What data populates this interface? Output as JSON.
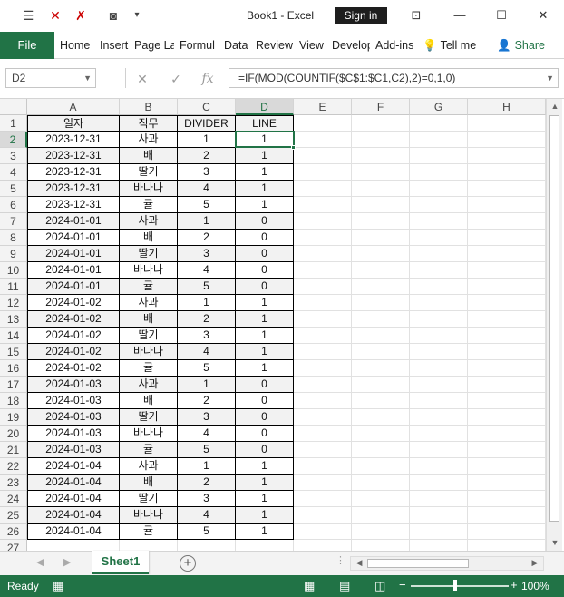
{
  "app": {
    "title": "Book1  -  Excel",
    "signin_label": "Sign in"
  },
  "quick_access": [
    {
      "icon": "form-icon",
      "glyph": "☰"
    },
    {
      "icon": "delete-cells-icon",
      "glyph": "✕"
    },
    {
      "icon": "clear-icon",
      "glyph": "✗"
    },
    {
      "icon": "camera-icon",
      "glyph": "◙"
    },
    {
      "icon": "customize-qat-icon",
      "glyph": "▾"
    }
  ],
  "window_buttons": [
    {
      "icon": "ribbon-display-icon",
      "glyph": "⊡"
    },
    {
      "icon": "minimize-icon",
      "glyph": "—"
    },
    {
      "icon": "maximize-icon",
      "glyph": "☐"
    },
    {
      "icon": "close-icon",
      "glyph": "✕"
    }
  ],
  "ribbon": {
    "file_label": "File",
    "tabs": [
      "Home",
      "Insert",
      "Page La",
      "Formul",
      "Data",
      "Review",
      "View",
      "Develop",
      "Add-ins"
    ],
    "tell_me": "Tell me",
    "share": "Share"
  },
  "formula_bar": {
    "name_box": "D2",
    "cancel_glyph": "✕",
    "enter_glyph": "✓",
    "fx_glyph": "fx",
    "formula": "=IF(MOD(COUNTIF($C$1:$C1,C2),2)=0,1,0)"
  },
  "grid": {
    "columns": [
      "A",
      "B",
      "C",
      "D",
      "E",
      "F",
      "G",
      "H"
    ],
    "row_numbers": [
      "1",
      "2",
      "3",
      "4",
      "5",
      "6",
      "7",
      "8",
      "9",
      "10",
      "11",
      "12",
      "13",
      "14",
      "15",
      "16",
      "17",
      "18",
      "19",
      "20",
      "21",
      "22",
      "23",
      "24",
      "25",
      "26",
      "27"
    ],
    "selected_cell": "D2",
    "header_row": [
      "일자",
      "직무",
      "DIVIDER",
      "LINE"
    ],
    "rows": [
      [
        "2023-12-31",
        "사과",
        "1",
        "1"
      ],
      [
        "2023-12-31",
        "배",
        "2",
        "1"
      ],
      [
        "2023-12-31",
        "딸기",
        "3",
        "1"
      ],
      [
        "2023-12-31",
        "바나나",
        "4",
        "1"
      ],
      [
        "2023-12-31",
        "귤",
        "5",
        "1"
      ],
      [
        "2024-01-01",
        "사과",
        "1",
        "0"
      ],
      [
        "2024-01-01",
        "배",
        "2",
        "0"
      ],
      [
        "2024-01-01",
        "딸기",
        "3",
        "0"
      ],
      [
        "2024-01-01",
        "바나나",
        "4",
        "0"
      ],
      [
        "2024-01-01",
        "귤",
        "5",
        "0"
      ],
      [
        "2024-01-02",
        "사과",
        "1",
        "1"
      ],
      [
        "2024-01-02",
        "배",
        "2",
        "1"
      ],
      [
        "2024-01-02",
        "딸기",
        "3",
        "1"
      ],
      [
        "2024-01-02",
        "바나나",
        "4",
        "1"
      ],
      [
        "2024-01-02",
        "귤",
        "5",
        "1"
      ],
      [
        "2024-01-03",
        "사과",
        "1",
        "0"
      ],
      [
        "2024-01-03",
        "배",
        "2",
        "0"
      ],
      [
        "2024-01-03",
        "딸기",
        "3",
        "0"
      ],
      [
        "2024-01-03",
        "바나나",
        "4",
        "0"
      ],
      [
        "2024-01-03",
        "귤",
        "5",
        "0"
      ],
      [
        "2024-01-04",
        "사과",
        "1",
        "1"
      ],
      [
        "2024-01-04",
        "배",
        "2",
        "1"
      ],
      [
        "2024-01-04",
        "딸기",
        "3",
        "1"
      ],
      [
        "2024-01-04",
        "바나나",
        "4",
        "1"
      ],
      [
        "2024-01-04",
        "귤",
        "5",
        "1"
      ]
    ]
  },
  "sheets": {
    "active": "Sheet1"
  },
  "status": {
    "ready": "Ready",
    "zoom": "100%",
    "zoom_level": 1.0
  },
  "colors": {
    "accent": "#217346",
    "row_shade": "#f2f2f2"
  }
}
